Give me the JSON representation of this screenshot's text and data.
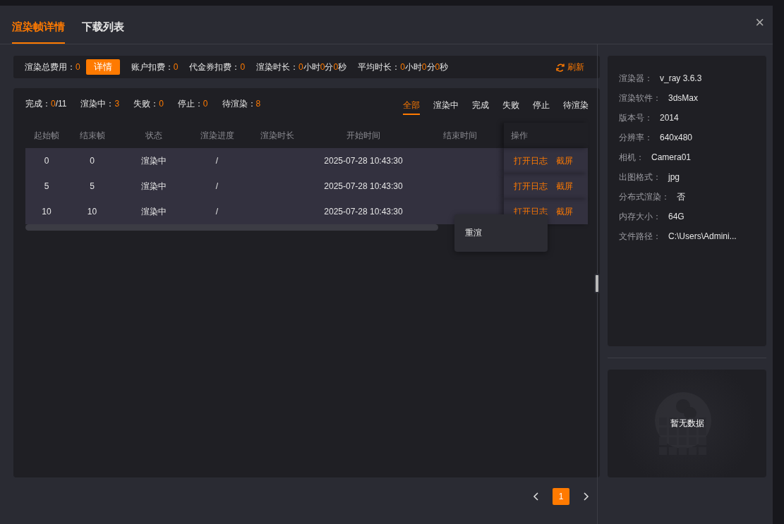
{
  "tabs": [
    {
      "label": "渲染帧详情",
      "selected": true
    },
    {
      "label": "下载列表",
      "selected": false
    }
  ],
  "close": "×",
  "summary": {
    "items": [
      {
        "label": "渲染总费用：",
        "value": [
          {
            "t": "0",
            "hl": true
          }
        ],
        "detail_button": "详情"
      },
      {
        "label": "账户扣费：",
        "value": [
          {
            "t": "0",
            "hl": true
          }
        ]
      },
      {
        "label": "代金券扣费：",
        "value": [
          {
            "t": "0",
            "hl": true
          }
        ]
      },
      {
        "label": "渲染时长：",
        "value": [
          {
            "t": "0",
            "hl": true
          },
          {
            "t": "小时",
            "hl": false
          },
          {
            "t": "0",
            "hl": true
          },
          {
            "t": "分",
            "hl": false
          },
          {
            "t": "0",
            "hl": true
          },
          {
            "t": "秒",
            "hl": false
          }
        ]
      },
      {
        "label": "平均时长：",
        "value": [
          {
            "t": "0",
            "hl": true
          },
          {
            "t": "小时",
            "hl": false
          },
          {
            "t": "0",
            "hl": true
          },
          {
            "t": "分",
            "hl": false
          },
          {
            "t": "0",
            "hl": true
          },
          {
            "t": "秒",
            "hl": false
          }
        ]
      }
    ],
    "refresh": "刷新"
  },
  "stats": [
    {
      "label": "完成：",
      "value": "0",
      "total": "/11"
    },
    {
      "label": "渲染中：",
      "value": "3"
    },
    {
      "label": "失败：",
      "value": "0"
    },
    {
      "label": "停止：",
      "value": "0"
    },
    {
      "label": "待渲染：",
      "value": "8"
    }
  ],
  "filters": [
    {
      "label": "全部",
      "selected": true
    },
    {
      "label": "渲染中",
      "selected": false
    },
    {
      "label": "完成",
      "selected": false
    },
    {
      "label": "失败",
      "selected": false
    },
    {
      "label": "停止",
      "selected": false
    },
    {
      "label": "待渲染",
      "selected": false
    }
  ],
  "table": {
    "columns": [
      "起始帧",
      "结束帧",
      "状态",
      "渲染进度",
      "渲染时长",
      "开始时间",
      "结束时间",
      "操作"
    ],
    "rows": [
      {
        "cells": [
          "0",
          "0",
          "渲染中",
          "/",
          "",
          "2025-07-28 10:43:30",
          ""
        ],
        "actions": [
          "打开日志",
          "截屏"
        ]
      },
      {
        "cells": [
          "5",
          "5",
          "渲染中",
          "/",
          "",
          "2025-07-28 10:43:30",
          ""
        ],
        "actions": [
          "打开日志",
          "截屏"
        ]
      },
      {
        "cells": [
          "10",
          "10",
          "渲染中",
          "/",
          "",
          "2025-07-28 10:43:30",
          ""
        ],
        "actions": [
          "打开日志",
          "截屏"
        ]
      }
    ]
  },
  "context_menu": [
    "重渲"
  ],
  "pagination": {
    "pages": [
      {
        "label": "1",
        "selected": true
      }
    ]
  },
  "info": [
    {
      "label": "渲染器：",
      "value": "v_ray 3.6.3"
    },
    {
      "label": "渲染软件：",
      "value": "3dsMax"
    },
    {
      "label": "版本号：",
      "value": "2014"
    },
    {
      "label": "分辨率：",
      "value": "640x480"
    },
    {
      "label": "相机：",
      "value": "Camera01"
    },
    {
      "label": "出图格式：",
      "value": "jpg"
    },
    {
      "label": "分布式渲染：",
      "value": "否"
    },
    {
      "label": "内存大小：",
      "value": "64G"
    },
    {
      "label": "文件路径：",
      "value": "C:\\Users\\Admini..."
    }
  ],
  "preview": {
    "empty_text": "暂无数据"
  }
}
